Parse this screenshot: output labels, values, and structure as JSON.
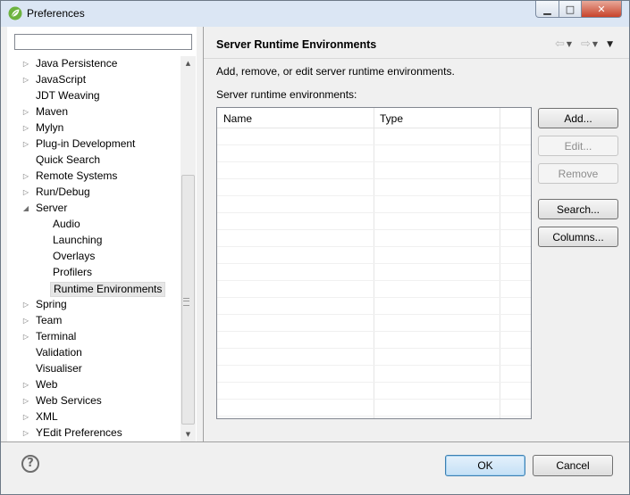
{
  "window": {
    "title": "Preferences",
    "icon": "spring-leaf-icon",
    "controls": [
      "minimize",
      "maximize",
      "close"
    ]
  },
  "filter": {
    "value": "",
    "placeholder": ""
  },
  "tree": {
    "items": [
      {
        "label": "Java Persistence",
        "level": 0,
        "expander": "collapsed"
      },
      {
        "label": "JavaScript",
        "level": 0,
        "expander": "collapsed"
      },
      {
        "label": "JDT Weaving",
        "level": 0,
        "expander": "none"
      },
      {
        "label": "Maven",
        "level": 0,
        "expander": "collapsed"
      },
      {
        "label": "Mylyn",
        "level": 0,
        "expander": "collapsed"
      },
      {
        "label": "Plug-in Development",
        "level": 0,
        "expander": "collapsed"
      },
      {
        "label": "Quick Search",
        "level": 0,
        "expander": "none"
      },
      {
        "label": "Remote Systems",
        "level": 0,
        "expander": "collapsed"
      },
      {
        "label": "Run/Debug",
        "level": 0,
        "expander": "collapsed"
      },
      {
        "label": "Server",
        "level": 0,
        "expander": "expanded"
      },
      {
        "label": "Audio",
        "level": 1,
        "expander": "none"
      },
      {
        "label": "Launching",
        "level": 1,
        "expander": "none"
      },
      {
        "label": "Overlays",
        "level": 1,
        "expander": "none"
      },
      {
        "label": "Profilers",
        "level": 1,
        "expander": "none"
      },
      {
        "label": "Runtime Environments",
        "level": 1,
        "expander": "none",
        "selected": true
      },
      {
        "label": "Spring",
        "level": 0,
        "expander": "collapsed"
      },
      {
        "label": "Team",
        "level": 0,
        "expander": "collapsed"
      },
      {
        "label": "Terminal",
        "level": 0,
        "expander": "collapsed"
      },
      {
        "label": "Validation",
        "level": 0,
        "expander": "none"
      },
      {
        "label": "Visualiser",
        "level": 0,
        "expander": "none"
      },
      {
        "label": "Web",
        "level": 0,
        "expander": "collapsed"
      },
      {
        "label": "Web Services",
        "level": 0,
        "expander": "collapsed"
      },
      {
        "label": "XML",
        "level": 0,
        "expander": "collapsed"
      },
      {
        "label": "YEdit Preferences",
        "level": 0,
        "expander": "collapsed"
      }
    ]
  },
  "page": {
    "title": "Server Runtime Environments",
    "description": "Add, remove, or edit server runtime environments.",
    "list_label": "Server runtime environments:",
    "nav": {
      "back_icon": "back-arrow-icon",
      "forward_icon": "forward-arrow-icon",
      "menu_icon": "view-menu-icon"
    }
  },
  "table": {
    "columns": [
      "Name",
      "Type",
      ""
    ],
    "rows": []
  },
  "buttons": {
    "add": "Add...",
    "edit": "Edit...",
    "remove": "Remove",
    "search": "Search...",
    "columns": "Columns..."
  },
  "footer": {
    "help_label": "?",
    "ok": "OK",
    "cancel": "Cancel"
  }
}
